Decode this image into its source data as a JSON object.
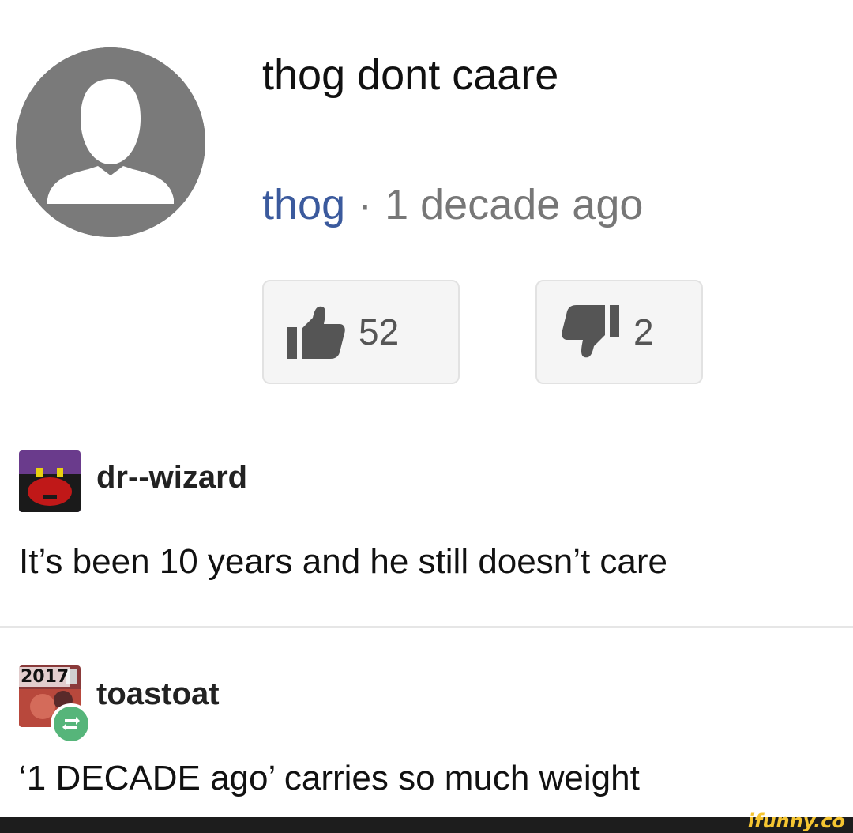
{
  "yt_comment": {
    "text": "thog dont caare",
    "author": "thog",
    "separator": "·",
    "timestamp": "1 decade ago",
    "likes": "52",
    "dislikes": "2",
    "avatar_icon": "default-user-silhouette-icon",
    "like_icon": "thumbs-up-icon",
    "dislike_icon": "thumbs-down-icon",
    "author_color": "#3b5a9d"
  },
  "replies": [
    {
      "username": "dr--wizard",
      "body": "It’s been 10 years and he still doesn’t care"
    },
    {
      "username": "toastoat",
      "body": "‘1 DECADE ago’ carries so much weight",
      "avatar_text": "2017",
      "badge_icon": "reblog-icon",
      "badge_color": "#56b57a"
    }
  ],
  "watermark": {
    "text": "ifunny.co",
    "color": "#f5c531"
  }
}
